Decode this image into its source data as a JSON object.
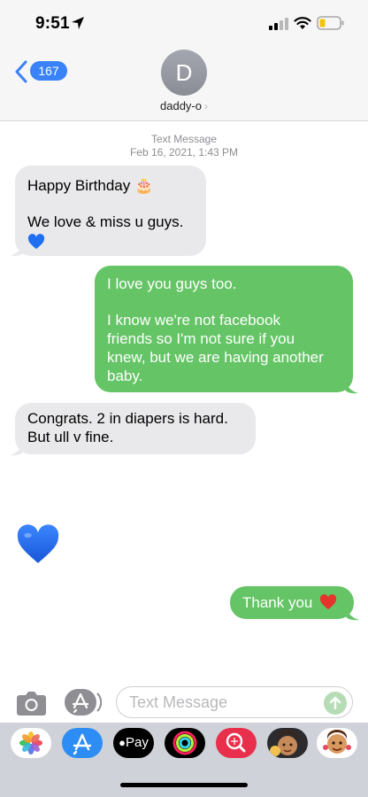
{
  "status_bar": {
    "time": "9:51"
  },
  "header": {
    "back_count": "167",
    "avatar_initial": "D",
    "contact_name": "daddy-o",
    "contact_chevron": "›"
  },
  "thread": {
    "service": "Text Message",
    "timestamp": "Feb 16, 2021, 1:43 PM",
    "messages": [
      {
        "from": "them",
        "lines": [
          "Happy Birthday 🎂",
          "We love & miss u guys."
        ],
        "emoji": "blue-heart"
      },
      {
        "from": "me",
        "lines": [
          "I love you guys too.",
          "I know we're not facebook",
          "friends so I'm not sure if you",
          "knew, but we are having another",
          "baby."
        ]
      },
      {
        "from": "them",
        "lines": [
          "Congrats. 2 in diapers is hard.",
          "But ull v fine."
        ]
      },
      {
        "from": "them",
        "emoji_only": "blue-heart"
      },
      {
        "from": "me",
        "text": "Thank you",
        "emoji": "red-heart"
      }
    ]
  },
  "composer": {
    "placeholder": "Text Message"
  },
  "app_drawer": {
    "apps": [
      {
        "name": "photos-app-icon"
      },
      {
        "name": "app-store-icon"
      },
      {
        "name": "apple-pay-icon",
        "label": "Pay"
      },
      {
        "name": "activity-icon"
      },
      {
        "name": "web-images-search-icon"
      },
      {
        "name": "memoji-icon"
      },
      {
        "name": "memoji-stickers-icon"
      }
    ]
  },
  "colors": {
    "outgoing": "#65c466",
    "incoming": "#e9e9eb",
    "accent": "#3a82f7",
    "blue_heart": "#1e6ff2",
    "red_heart": "#e5342c"
  }
}
